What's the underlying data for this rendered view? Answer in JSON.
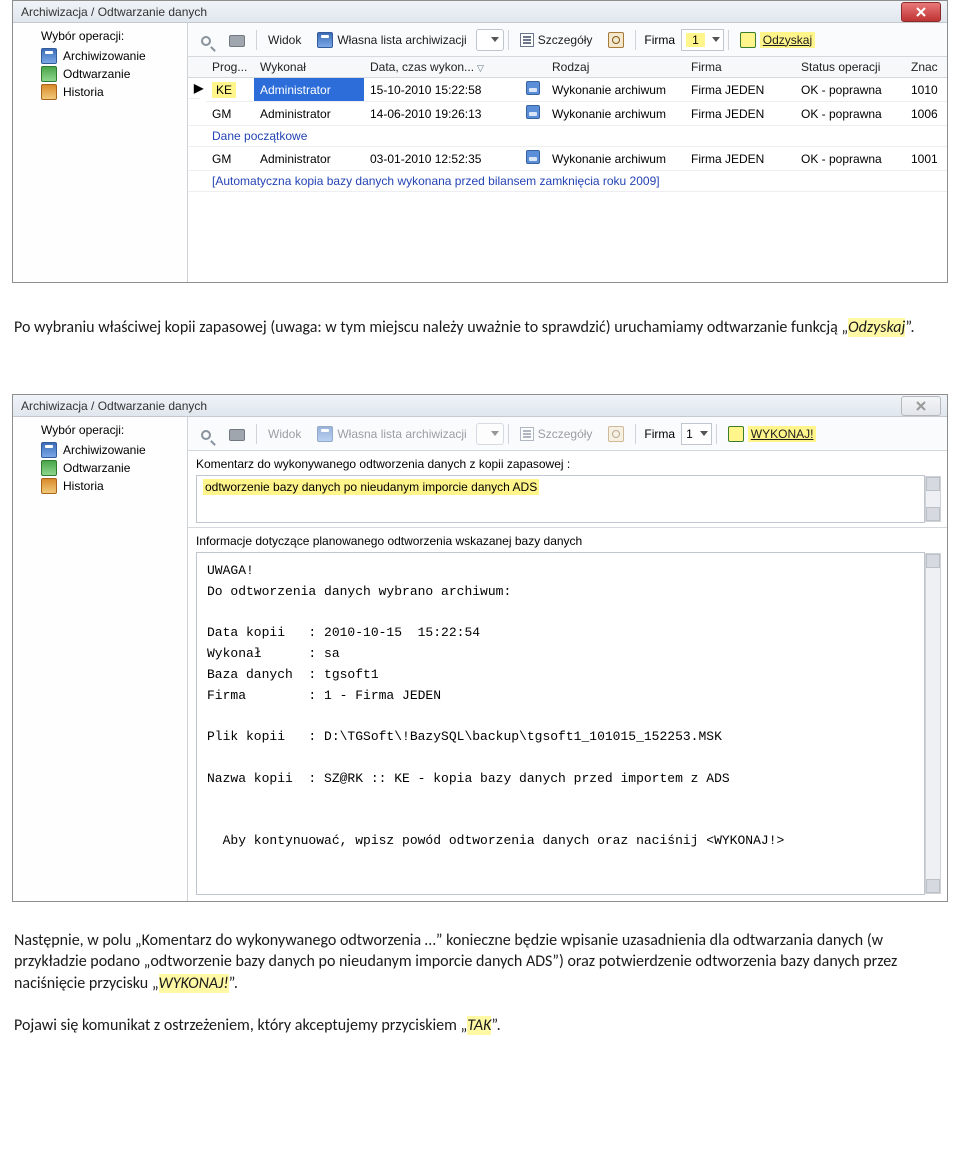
{
  "shot1": {
    "title": "Archiwizacja / Odtwarzanie danych",
    "sidebar_title": "Wybór operacji:",
    "tree": [
      "Archiwizowanie",
      "Odtwarzanie",
      "Historia"
    ],
    "toolbar": {
      "widok": "Widok",
      "wlasna": "Własna lista archiwizacji",
      "szczegoly": "Szczegóły",
      "firma": "Firma",
      "firma_val": "1",
      "odzyskaj": "Odzyskaj"
    },
    "cols": {
      "prog": "Prog...",
      "wykonal": "Wykonał",
      "data": "Data, czas wykon...",
      "rodzaj": "Rodzaj",
      "firma": "Firma",
      "status": "Status operacji",
      "znac": "Znac"
    },
    "rows": [
      {
        "mark": "▶",
        "prog": "KE",
        "wykonal": "Administrator",
        "data": "15-10-2010 15:22:58",
        "rodzaj": "Wykonanie archiwum",
        "firma": "Firma JEDEN",
        "status": "OK - poprawna",
        "znac": "1010",
        "sel": true
      },
      {
        "mark": "",
        "prog": "GM",
        "wykonal": "Administrator",
        "data": "14-06-2010 19:26:13",
        "rodzaj": "Wykonanie archiwum",
        "firma": "Firma JEDEN",
        "status": "OK - poprawna",
        "znac": "1006",
        "sel": false
      },
      {
        "note": "Dane początkowe"
      },
      {
        "mark": "",
        "prog": "GM",
        "wykonal": "Administrator",
        "data": "03-01-2010 12:52:35",
        "rodzaj": "Wykonanie archiwum",
        "firma": "Firma JEDEN",
        "status": "OK - poprawna",
        "znac": "1001",
        "sel": false
      },
      {
        "note": "[Automatyczna kopia bazy danych wykonana przed bilansem zamknięcia roku 2009]"
      }
    ]
  },
  "para1": {
    "a": "Po wybraniu właściwej kopii zapasowej (uwaga: w tym miejscu należy uważnie to sprawdzić) uruchamiamy odtwarzanie funkcją „",
    "b": "Odzyskaj",
    "c": "”."
  },
  "shot2": {
    "title": "Archiwizacja / Odtwarzanie danych",
    "sidebar_title": "Wybór operacji:",
    "tree": [
      "Archiwizowanie",
      "Odtwarzanie",
      "Historia"
    ],
    "toolbar": {
      "widok": "Widok",
      "wlasna": "Własna lista archiwizacji",
      "szczegoly": "Szczegóły",
      "firma": "Firma",
      "firma_val": "1",
      "wykonaj": "WYKONAJ!"
    },
    "comment_label": "Komentarz do wykonywanego odtworzenia danych z kopii zapasowej :",
    "comment_value": "odtworzenie bazy danych po nieudanym imporcie danych ADS",
    "info_label": "Informacje dotyczące planowanego odtworzenia wskazanej bazy danych",
    "info_text": "UWAGA!\nDo odtworzenia danych wybrano archiwum:\n\nData kopii   : 2010-10-15  15:22:54\nWykonał      : sa\nBaza danych  : tgsoft1\nFirma        : 1 - Firma JEDEN\n\nPlik kopii   : D:\\TGSoft\\!BazySQL\\backup\\tgsoft1_101015_152253.MSK\n\nNazwa kopii  : SZ@RK :: KE - kopia bazy danych przed importem z ADS\n\n\n  Aby kontynuować, wpisz powód odtworzenia danych oraz naciśnij <WYKONAJ!>"
  },
  "para2": {
    "a": "Następnie, w polu „Komentarz do wykonywanego odtworzenia …” konieczne będzie wpisanie uzasadnienia dla odtwarzania danych  (w przykładzie  podano „odtworzenie bazy danych po nieudanym imporcie danych ADS”) oraz potwierdzenie odtworzenia bazy danych przez naciśnięcie przycisku „",
    "b": "WYKONAJ!",
    "c": "”."
  },
  "para3": {
    "a": "Pojawi się komunikat z ostrzeżeniem, który akceptujemy przyciskiem „",
    "b": "TAK",
    "c": "”."
  }
}
